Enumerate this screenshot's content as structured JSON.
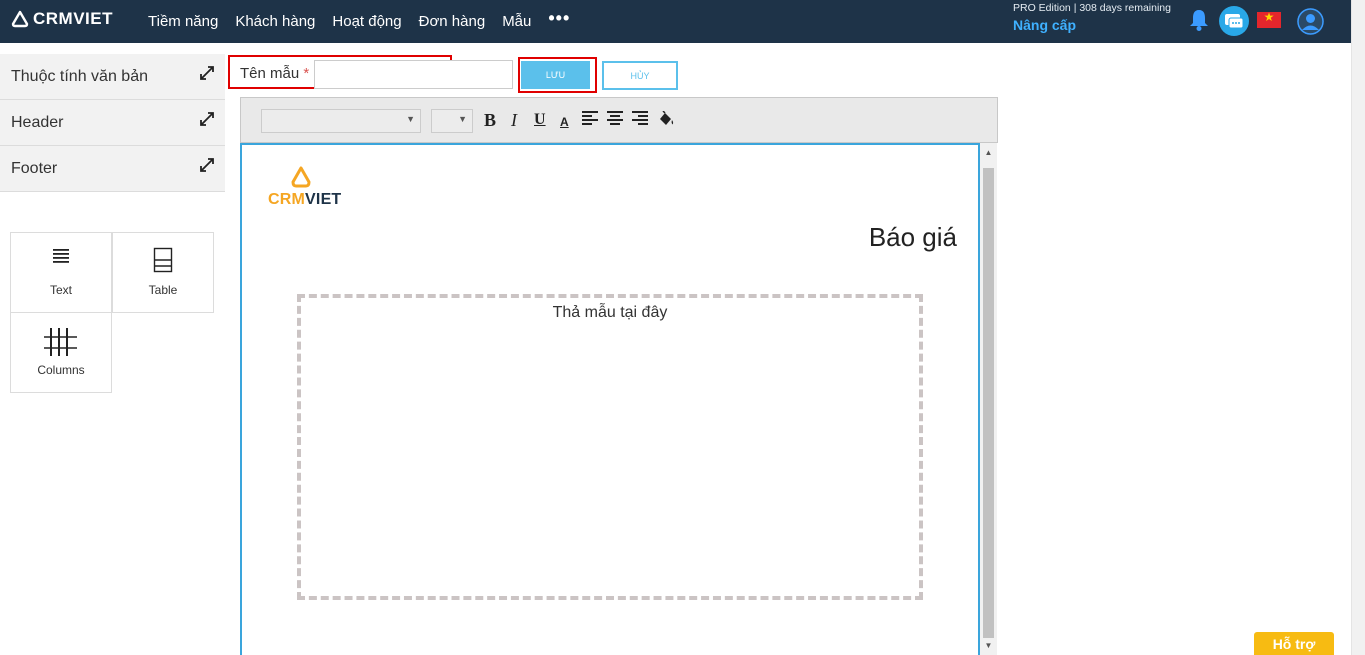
{
  "brand": {
    "logo_text": "CRMVIET"
  },
  "nav": {
    "items": [
      "Tiềm năng",
      "Khách hàng",
      "Hoạt động",
      "Đơn hàng",
      "Mẫu"
    ],
    "more": "•••"
  },
  "account": {
    "edition": "PRO Edition | 308 days remaining",
    "upgrade": "Nâng cấp",
    "flag_star": "★"
  },
  "sidebar": {
    "sections": [
      {
        "label": "Thuộc tính văn bản"
      },
      {
        "label": "Header"
      },
      {
        "label": "Footer"
      }
    ],
    "blocks": [
      {
        "label": "Text",
        "icon": "text-lines-icon"
      },
      {
        "label": "Table",
        "icon": "table-icon"
      },
      {
        "label": "Columns",
        "icon": "columns-icon"
      }
    ]
  },
  "form": {
    "name_label": "Tên mẫu",
    "required_mark": "*",
    "name_value": "",
    "save_label": "LƯU",
    "cancel_label": "HỦY"
  },
  "toolbar": {
    "font_family": "",
    "font_size": "",
    "bold": "B",
    "italic": "I",
    "underline": "U",
    "font_color": "A",
    "dropdown_arrow": "▼"
  },
  "document": {
    "logo_part1": "CRM",
    "logo_part2": "VIET",
    "title": "Báo giá",
    "dropzone_text": "Thả mẫu tại đây"
  },
  "scroll": {
    "up": "▲",
    "down": "▼"
  },
  "support": {
    "label": "Hỗ trợ"
  },
  "colors": {
    "navbar": "#1e3348",
    "accent": "#5bc0eb",
    "highlight": "#e00000",
    "brand_orange": "#f5a623",
    "support": "#f7bb12"
  }
}
